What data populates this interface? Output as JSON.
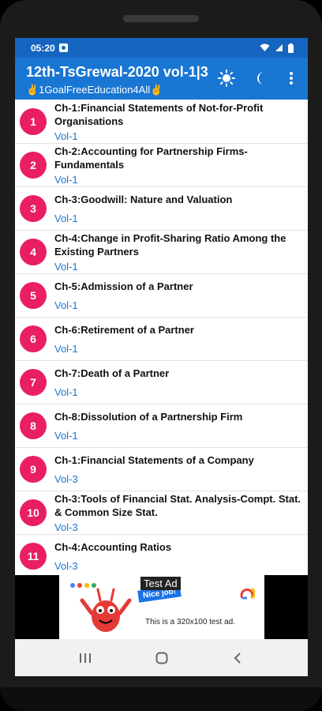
{
  "status": {
    "time": "05:20"
  },
  "appbar": {
    "title": "12th-TsGrewal-2020 vol-1|3",
    "subtitle": "✌1GoalFreeEducation4All✌"
  },
  "colors": {
    "primary": "#1976d2",
    "status": "#1565c0",
    "badge": "#e91e63",
    "vol": "#1976d2"
  },
  "icons": {
    "theme_light": "sun-icon",
    "theme_dark": "moon-icon",
    "menu": "more-vert-icon"
  },
  "chapters": [
    {
      "num": "1",
      "title": "Ch-1:Financial Statements of Not-for-Profit Organisations",
      "vol": "Vol-1"
    },
    {
      "num": "2",
      "title": "Ch-2:Accounting for Partnership Firms-Fundamentals",
      "vol": "Vol-1"
    },
    {
      "num": "3",
      "title": "Ch-3:Goodwill: Nature and Valuation",
      "vol": "Vol-1"
    },
    {
      "num": "4",
      "title": "Ch-4:Change in Profit-Sharing Ratio Among the Existing Partners",
      "vol": "Vol-1"
    },
    {
      "num": "5",
      "title": "Ch-5:Admission of a Partner",
      "vol": "Vol-1"
    },
    {
      "num": "6",
      "title": "Ch-6:Retirement of a Partner",
      "vol": "Vol-1"
    },
    {
      "num": "7",
      "title": "Ch-7:Death of a Partner",
      "vol": "Vol-1"
    },
    {
      "num": "8",
      "title": "Ch-8:Dissolution of a Partnership Firm",
      "vol": "Vol-1"
    },
    {
      "num": "9",
      "title": "Ch-1:Financial Statements of a Company",
      "vol": "Vol-3"
    },
    {
      "num": "10",
      "title": "Ch-3:Tools of Financial Stat. Analysis-Compt. Stat. & Common Size Stat.",
      "vol": "Vol-3"
    },
    {
      "num": "11",
      "title": "Ch-4:Accounting Ratios",
      "vol": "Vol-3"
    }
  ],
  "ad": {
    "label": "Test Ad",
    "badge_text": "Nice job!",
    "text": "This is a 320x100 test ad."
  }
}
